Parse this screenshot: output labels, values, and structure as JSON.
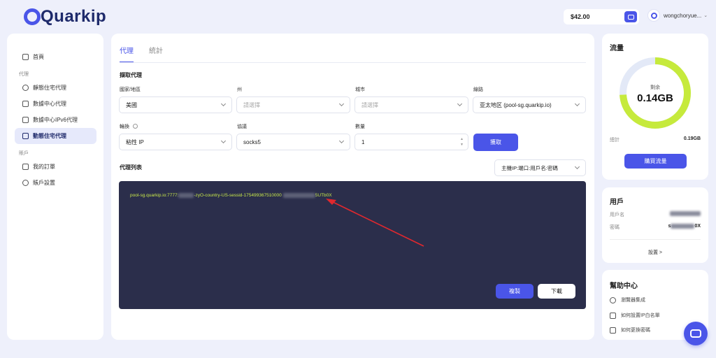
{
  "brand": {
    "name": "Quarkip"
  },
  "header": {
    "balance": "$42.00",
    "username": "wongchoryue..."
  },
  "sidebar": {
    "home": "首頁",
    "group_proxy": "代理",
    "items": [
      "靜態住宅代理",
      "數據中心代理",
      "數據中心IPv6代理",
      "動態住宅代理"
    ],
    "group_account": "賬戶",
    "account_items": [
      "我的訂單",
      "賬戶設置"
    ]
  },
  "main": {
    "tabs": [
      "代理",
      "統計"
    ],
    "extract_title": "擷取代理",
    "fields": {
      "country_label": "國家/地區",
      "country_value": "美國",
      "state_label": "州",
      "state_value": "請選擇",
      "city_label": "城市",
      "city_value": "請選擇",
      "line_label": "線路",
      "line_value": "亚太地区 (pool-sg.quarkip.io)",
      "rotation_label": "輪換",
      "rotation_value": "粘性 IP",
      "protocol_label": "協議",
      "protocol_value": "socks5",
      "quantity_label": "數量",
      "quantity_value": "1"
    },
    "extract_button": "獲取",
    "list_title": "代理列表",
    "format_value": "主機IP:端口:用戶名:密碼",
    "proxy_prefix": "pool-sg.quarkip.io:7777:",
    "proxy_middle": "-zyO-country-US-sessid-175499367510000",
    "proxy_suffix": "5UTb0X",
    "copy_button": "複製",
    "download_button": "下載"
  },
  "traffic": {
    "title": "流量",
    "remaining_label": "剩余",
    "remaining_value": "0.14GB",
    "total_label": "總計",
    "total_value": "0.19GB",
    "remaining_fraction": 0.74,
    "buy_button": "購買流量"
  },
  "user_card": {
    "title": "用戶",
    "username_label": "用戶名",
    "password_label": "密碼",
    "password_suffix": "0X",
    "settings_link": "設置 >"
  },
  "help": {
    "title": "幫助中心",
    "items": [
      "瀏覽器集成",
      "如何設置IP白名單",
      "如何更換密碼"
    ]
  },
  "colors": {
    "accent": "#4a55e8",
    "donut": "#c6ea3c",
    "donut_track": "#e3e9f7",
    "output_bg": "#2b2e4b"
  }
}
